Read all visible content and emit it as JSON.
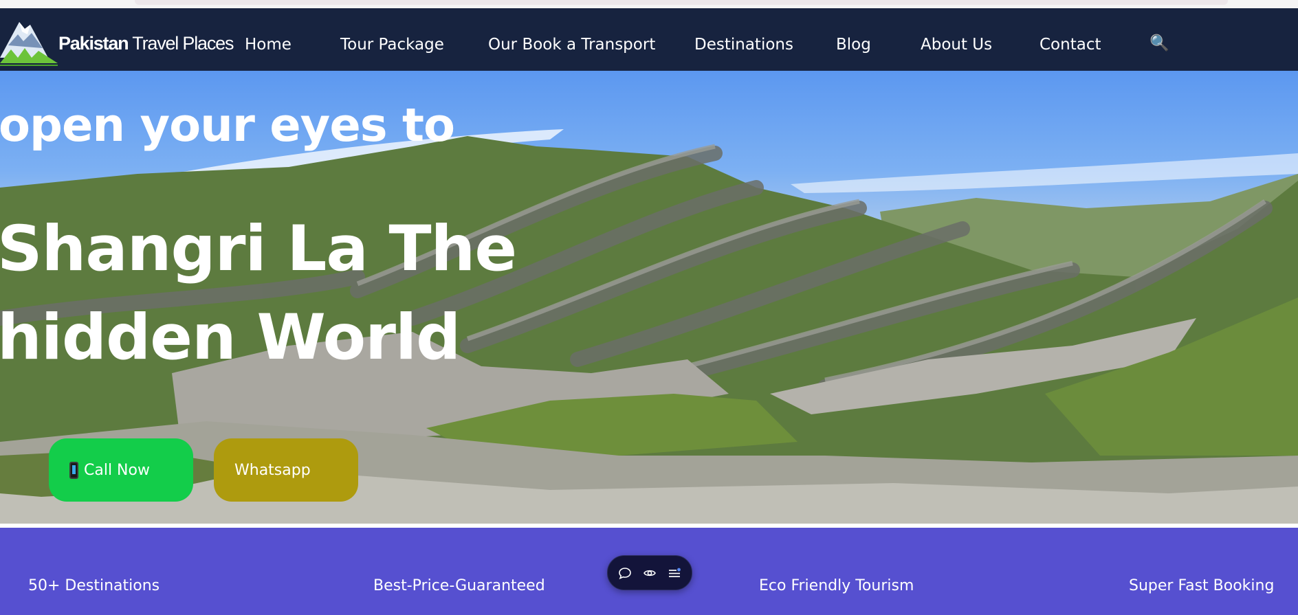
{
  "brand": {
    "name_bold": "Pakistan",
    "name_regular": "Travel Places"
  },
  "nav": {
    "items": [
      {
        "label": "Home"
      },
      {
        "label": "Tour Package"
      },
      {
        "label": "Our Book a Transport"
      },
      {
        "label": "Destinations"
      },
      {
        "label": "Blog"
      },
      {
        "label": "About Us"
      },
      {
        "label": "Contact"
      }
    ],
    "search_icon": "🔍"
  },
  "hero": {
    "line1": "open your eyes to",
    "line2": "Shangri La The",
    "line3": "hidden World",
    "call_button": "Call Now",
    "call_icon": "mobile-phone-icon",
    "whatsapp_button": "Whatsapp"
  },
  "features": {
    "items": [
      {
        "label": "50+ Destinations"
      },
      {
        "label": "Best-Price-Guaranteed"
      },
      {
        "label": "Eco Friendly Tourism"
      },
      {
        "label": "Super Fast Booking"
      }
    ]
  },
  "floating_toolbar": {
    "icons": [
      "chat-bubble-icon",
      "eye-icon",
      "menu-list-icon"
    ]
  },
  "colors": {
    "navbar": "#17233f",
    "call_button": "#13cd4a",
    "whatsapp_button": "#ae9b0e",
    "features_band": "#5650d0",
    "toolbar": "#13143a"
  }
}
